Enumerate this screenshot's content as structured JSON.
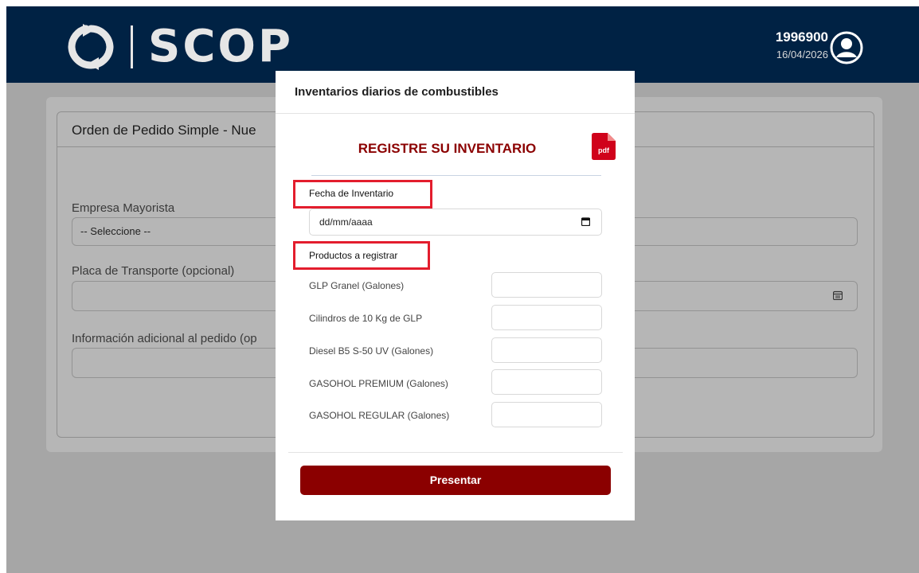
{
  "header": {
    "logo_text": "SCOP",
    "user_id": "1996900",
    "date": "16/04/2026"
  },
  "background_form": {
    "title": "Orden de Pedido Simple - Nue",
    "fields": [
      {
        "label": "Empresa Mayorista",
        "value": "-- Seleccione --"
      },
      {
        "label": "Placa de Transporte (opcional)",
        "value": ""
      },
      {
        "label": "Información adicional al pedido (op",
        "value": ""
      }
    ],
    "icons": [
      "calendar-icon"
    ]
  },
  "modal": {
    "title": "Inventarios diarios de combustibles",
    "heading": "REGISTRE SU INVENTARIO",
    "pdf_label": "pdf",
    "date_label": "Fecha de Inventario",
    "date_placeholder": "dd/mm/aaaa",
    "products_label": "Productos a registrar",
    "products": [
      {
        "label": "GLP Granel (Galones)",
        "value": ""
      },
      {
        "label": "Cilindros de 10 Kg de GLP",
        "value": ""
      },
      {
        "label": "Diesel B5 S-50 UV (Galones)",
        "value": ""
      },
      {
        "label": "GASOHOL PREMIUM (Galones)",
        "value": ""
      },
      {
        "label": "GASOHOL REGULAR (Galones)",
        "value": ""
      }
    ],
    "submit_label": "Presentar"
  },
  "colors": {
    "header_bg": "#002244",
    "accent": "#8b0000",
    "highlight": "#e31d2d",
    "overlay": "#a6a6a6"
  }
}
